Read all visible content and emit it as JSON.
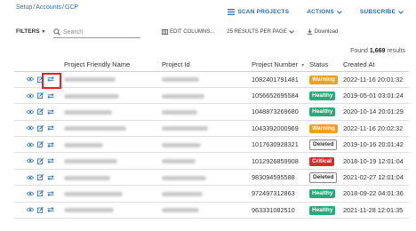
{
  "breadcrumb": {
    "items": [
      "Setup",
      "Accounts",
      "GCP"
    ],
    "separator": "/"
  },
  "top_actions": {
    "scan": "SCAN PROJECTS",
    "actions": "ACTIONS",
    "subscribe": "SUBSCRIBE"
  },
  "toolbar": {
    "filters": "FILTERS",
    "search_placeholder": "Search",
    "edit_columns": "EDIT COLUMNS...",
    "results_per_page": "25 RESULTS PER PAGE",
    "download": "Download"
  },
  "found": {
    "prefix": "Found",
    "count": "1,669",
    "suffix": "results"
  },
  "table": {
    "headers": [
      "Project Friendly Name",
      "Project Id",
      "Project Number",
      "Status",
      "Created At"
    ],
    "rows": [
      {
        "number": "1082401791481",
        "status": "Warning",
        "created": "2022-11-16 20:01:32"
      },
      {
        "number": "1056652695584",
        "status": "Healthy",
        "created": "2019-05-01 03:01:24"
      },
      {
        "number": "1048873269680",
        "status": "Healthy",
        "created": "2020-10-14 20:01:29"
      },
      {
        "number": "1043392000969",
        "status": "Warning",
        "created": "2022-11-16 20:02:32"
      },
      {
        "number": "1017630928321",
        "status": "Deleted",
        "created": "2019-10-16 20:01:42"
      },
      {
        "number": "1012926859908",
        "status": "Critical",
        "created": "2018-10-19 12:01:04"
      },
      {
        "number": "983094595588",
        "status": "Deleted",
        "created": "2021-02-27 12:01:04"
      },
      {
        "number": "972497312863",
        "status": "Healthy",
        "created": "2018-09-22 04:01:36"
      },
      {
        "number": "963331082510",
        "status": "Healthy",
        "created": "2021-11-28 12:01:35"
      }
    ]
  },
  "status_colors": {
    "Warning": "#f0a020",
    "Healthy": "#2aa87a",
    "Deleted": "#ffffff",
    "Critical": "#d82a2a"
  },
  "icons": [
    "eye-icon",
    "edit-icon",
    "transfer-icon",
    "search-icon",
    "download-icon",
    "chevron-down-icon"
  ]
}
